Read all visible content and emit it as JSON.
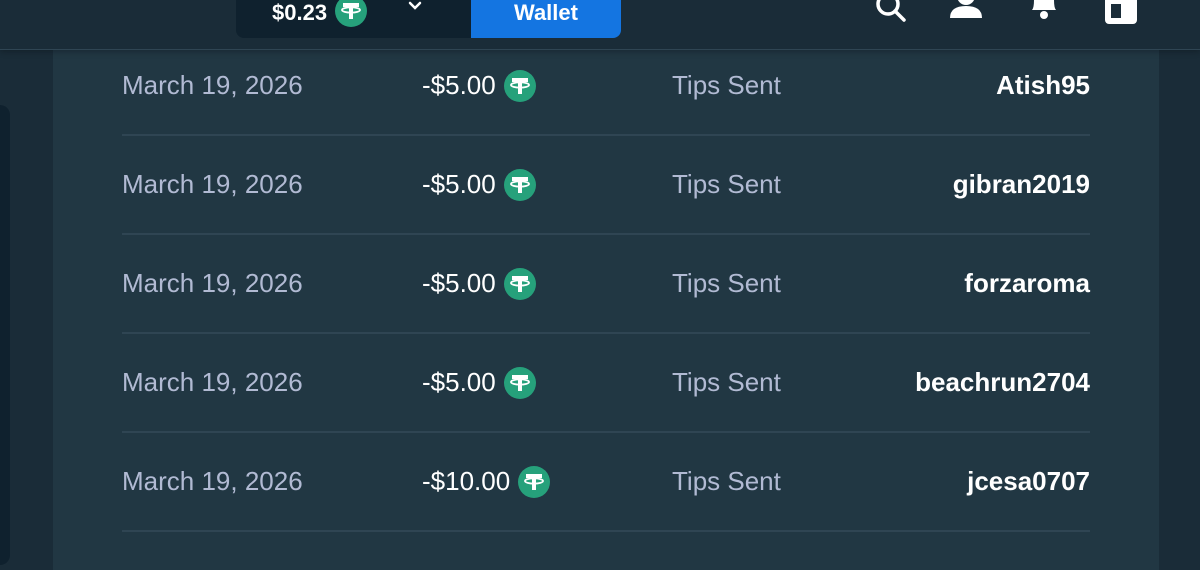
{
  "header": {
    "balance": "$0.23",
    "wallet_label": "Wallet",
    "icons": [
      "search-icon",
      "user-icon",
      "bell-icon",
      "menu-icon"
    ]
  },
  "colors": {
    "background": "#1a2c38",
    "card": "#213743",
    "accent_blue": "#1475e1",
    "tether_green": "#26a17b",
    "muted_text": "#b1bad3"
  },
  "transactions": [
    {
      "date": "March 19, 2026",
      "amount": "-$5.00",
      "type": "Tips Sent",
      "user": "Atish95"
    },
    {
      "date": "March 19, 2026",
      "amount": "-$5.00",
      "type": "Tips Sent",
      "user": "gibran2019"
    },
    {
      "date": "March 19, 2026",
      "amount": "-$5.00",
      "type": "Tips Sent",
      "user": "forzaroma"
    },
    {
      "date": "March 19, 2026",
      "amount": "-$5.00",
      "type": "Tips Sent",
      "user": "beachrun2704"
    },
    {
      "date": "March 19, 2026",
      "amount": "-$10.00",
      "type": "Tips Sent",
      "user": "jcesa0707"
    }
  ]
}
